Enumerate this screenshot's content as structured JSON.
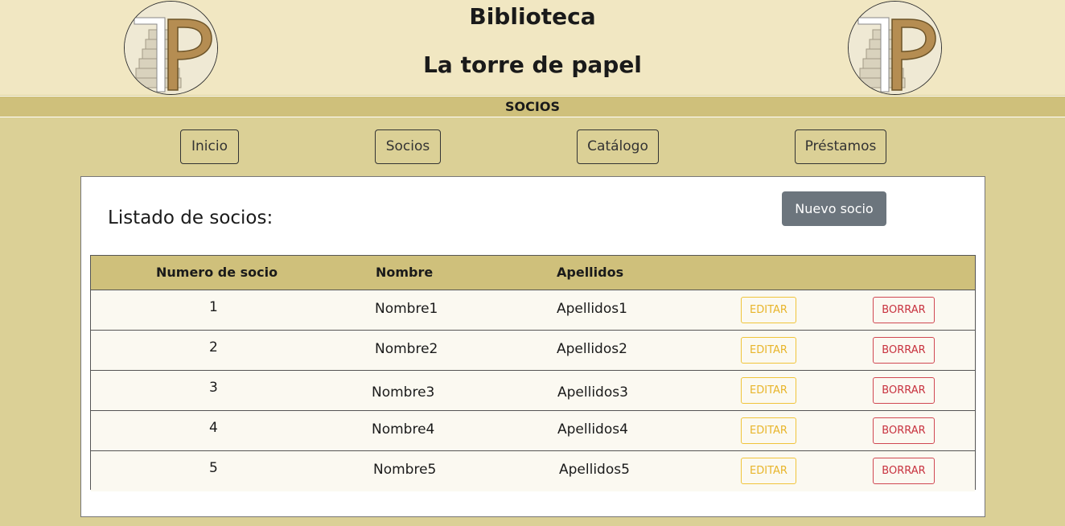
{
  "header": {
    "title_line1": "Biblioteca",
    "title_line2": "La torre de papel"
  },
  "section": {
    "label": "SOCIOS"
  },
  "nav": {
    "items": [
      {
        "label": "Inicio"
      },
      {
        "label": "Socios"
      },
      {
        "label": "Catálogo"
      },
      {
        "label": "Préstamos"
      }
    ]
  },
  "main": {
    "list_title": "Listado de socios:",
    "new_button": "Nuevo socio",
    "table": {
      "headers": [
        "Numero de socio",
        "Nombre",
        "Apellidos"
      ],
      "edit_label": "EDITAR",
      "delete_label": "BORRAR",
      "rows": [
        {
          "numero": "1",
          "nombre": "Nombre1",
          "apellidos": "Apellidos1"
        },
        {
          "numero": "2",
          "nombre": "Nombre2",
          "apellidos": "Apellidos2"
        },
        {
          "numero": "3",
          "nombre": "Nombre3",
          "apellidos": "Apellidos3"
        },
        {
          "numero": "4",
          "nombre": "Nombre4",
          "apellidos": "Apellidos4"
        },
        {
          "numero": "5",
          "nombre": "Nombre5",
          "apellidos": "Apellidos5"
        }
      ]
    }
  },
  "colors": {
    "header_bg": "#f1e7c2",
    "accent_bar": "#cfc07b",
    "page_bg": "#dbd096",
    "edit_color": "#e8b52a",
    "delete_color": "#c8323f",
    "secondary_button": "#6c757d"
  }
}
